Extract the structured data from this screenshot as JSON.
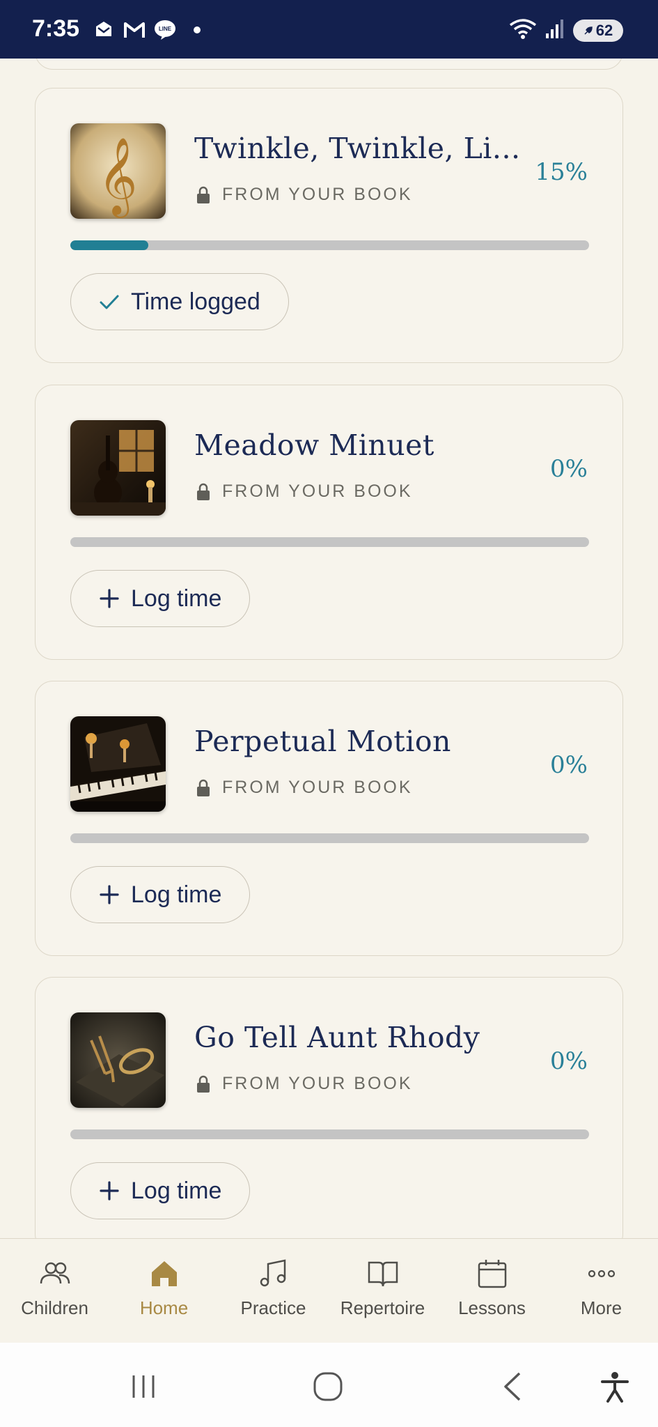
{
  "status_bar": {
    "time": "7:35",
    "battery": "62",
    "left_icons": [
      "mail-icon",
      "gmail-icon",
      "line-icon"
    ],
    "right_icons": [
      "wifi-icon",
      "signal-icon",
      "battery-icon"
    ]
  },
  "songs": [
    {
      "title": "Twinkle, Twinkle, Li...",
      "source": "FROM YOUR BOOK",
      "percent": "15%",
      "progress": 0.15,
      "action": "Time logged",
      "action_icon": "check-icon",
      "thumb": "treble-clef-art"
    },
    {
      "title": "Meadow Minuet",
      "source": "FROM YOUR BOOK",
      "percent": "0%",
      "progress": 0,
      "action": "Log time",
      "action_icon": "plus-icon",
      "thumb": "violin-art"
    },
    {
      "title": "Perpetual Motion",
      "source": "FROM YOUR BOOK",
      "percent": "0%",
      "progress": 0,
      "action": "Log time",
      "action_icon": "plus-icon",
      "thumb": "piano-art"
    },
    {
      "title": "Go Tell Aunt Rhody",
      "source": "FROM YOUR BOOK",
      "percent": "0%",
      "progress": 0,
      "action": "Log time",
      "action_icon": "plus-icon",
      "thumb": "tuning-fork-art"
    }
  ],
  "nav": {
    "items": [
      {
        "label": "Children",
        "icon": "people-icon"
      },
      {
        "label": "Home",
        "icon": "home-icon",
        "active": true
      },
      {
        "label": "Practice",
        "icon": "music-note-icon"
      },
      {
        "label": "Repertoire",
        "icon": "book-icon"
      },
      {
        "label": "Lessons",
        "icon": "calendar-icon"
      },
      {
        "label": "More",
        "icon": "more-icon"
      }
    ]
  },
  "colors": {
    "accent": "#217f94",
    "active_nav": "#a88944",
    "title": "#1c2a55",
    "background": "#f6f3ea",
    "status_bar": "#13204e"
  }
}
